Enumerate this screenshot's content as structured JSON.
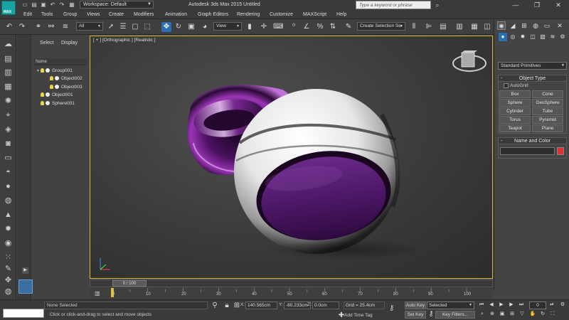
{
  "titlebar": {
    "logo_text": "MAX",
    "workspace": "Workspace: Default",
    "title": "Autodesk 3ds Max  2015     Untitled",
    "search_placeholder": "Type a keyword or phrase",
    "quick_icons": [
      "new-icon",
      "open-icon",
      "save-icon",
      "undo-icon",
      "redo-icon",
      "project-icon"
    ]
  },
  "menu": [
    "Edit",
    "Tools",
    "Group",
    "Views",
    "Create",
    "Modifiers",
    "Animation",
    "Graph Editors",
    "Rendering",
    "Customize",
    "MAXScript",
    "Help"
  ],
  "toolbar": {
    "filter": "All",
    "ref_coord": "View",
    "selection_set": "Create Selection Se"
  },
  "explorer": {
    "tabs": [
      "Select",
      "Display"
    ],
    "column_header": "Name",
    "items": [
      {
        "label": "Group001",
        "depth": 0,
        "expanded": true
      },
      {
        "label": "Object002",
        "depth": 1
      },
      {
        "label": "Object003",
        "depth": 1
      },
      {
        "label": "Object001",
        "depth": 0
      },
      {
        "label": "Sphere001",
        "depth": 0
      }
    ]
  },
  "viewport": {
    "label": "[ + ] [Orthographic ] [Realistic ]",
    "accent": "#d5b53a"
  },
  "command_panel": {
    "category": "Standard Primitives",
    "object_type_title": "Object Type",
    "autogrid": "AutoGrid",
    "buttons": [
      "Box",
      "Cone",
      "Sphere",
      "GeoSphere",
      "Cylinder",
      "Tube",
      "Torus",
      "Pyramid",
      "Teapot",
      "Plane"
    ],
    "name_color_title": "Name and Color",
    "swatch_color": "#e22e2e"
  },
  "timeline": {
    "slider_label": "0 / 100",
    "ticks": [
      "0",
      "10",
      "20",
      "30",
      "40",
      "50",
      "60",
      "70",
      "80",
      "90",
      "100"
    ]
  },
  "status": {
    "selection": "None Selected",
    "prompt": "Click or click-and-drag to select and move objects",
    "x_label": "X:",
    "x_value": "140.565cm",
    "y_label": "Y:",
    "y_value": "-80.233cm",
    "z_label": "Z:",
    "z_value": "0.0cm",
    "grid": "Grid = 25.4cm",
    "add_time_tag": "Add Time Tag",
    "auto_key": "Auto Key",
    "set_key": "Set Key",
    "key_mode": "Selected",
    "key_filters": "Key Filters...",
    "frame": "0"
  }
}
